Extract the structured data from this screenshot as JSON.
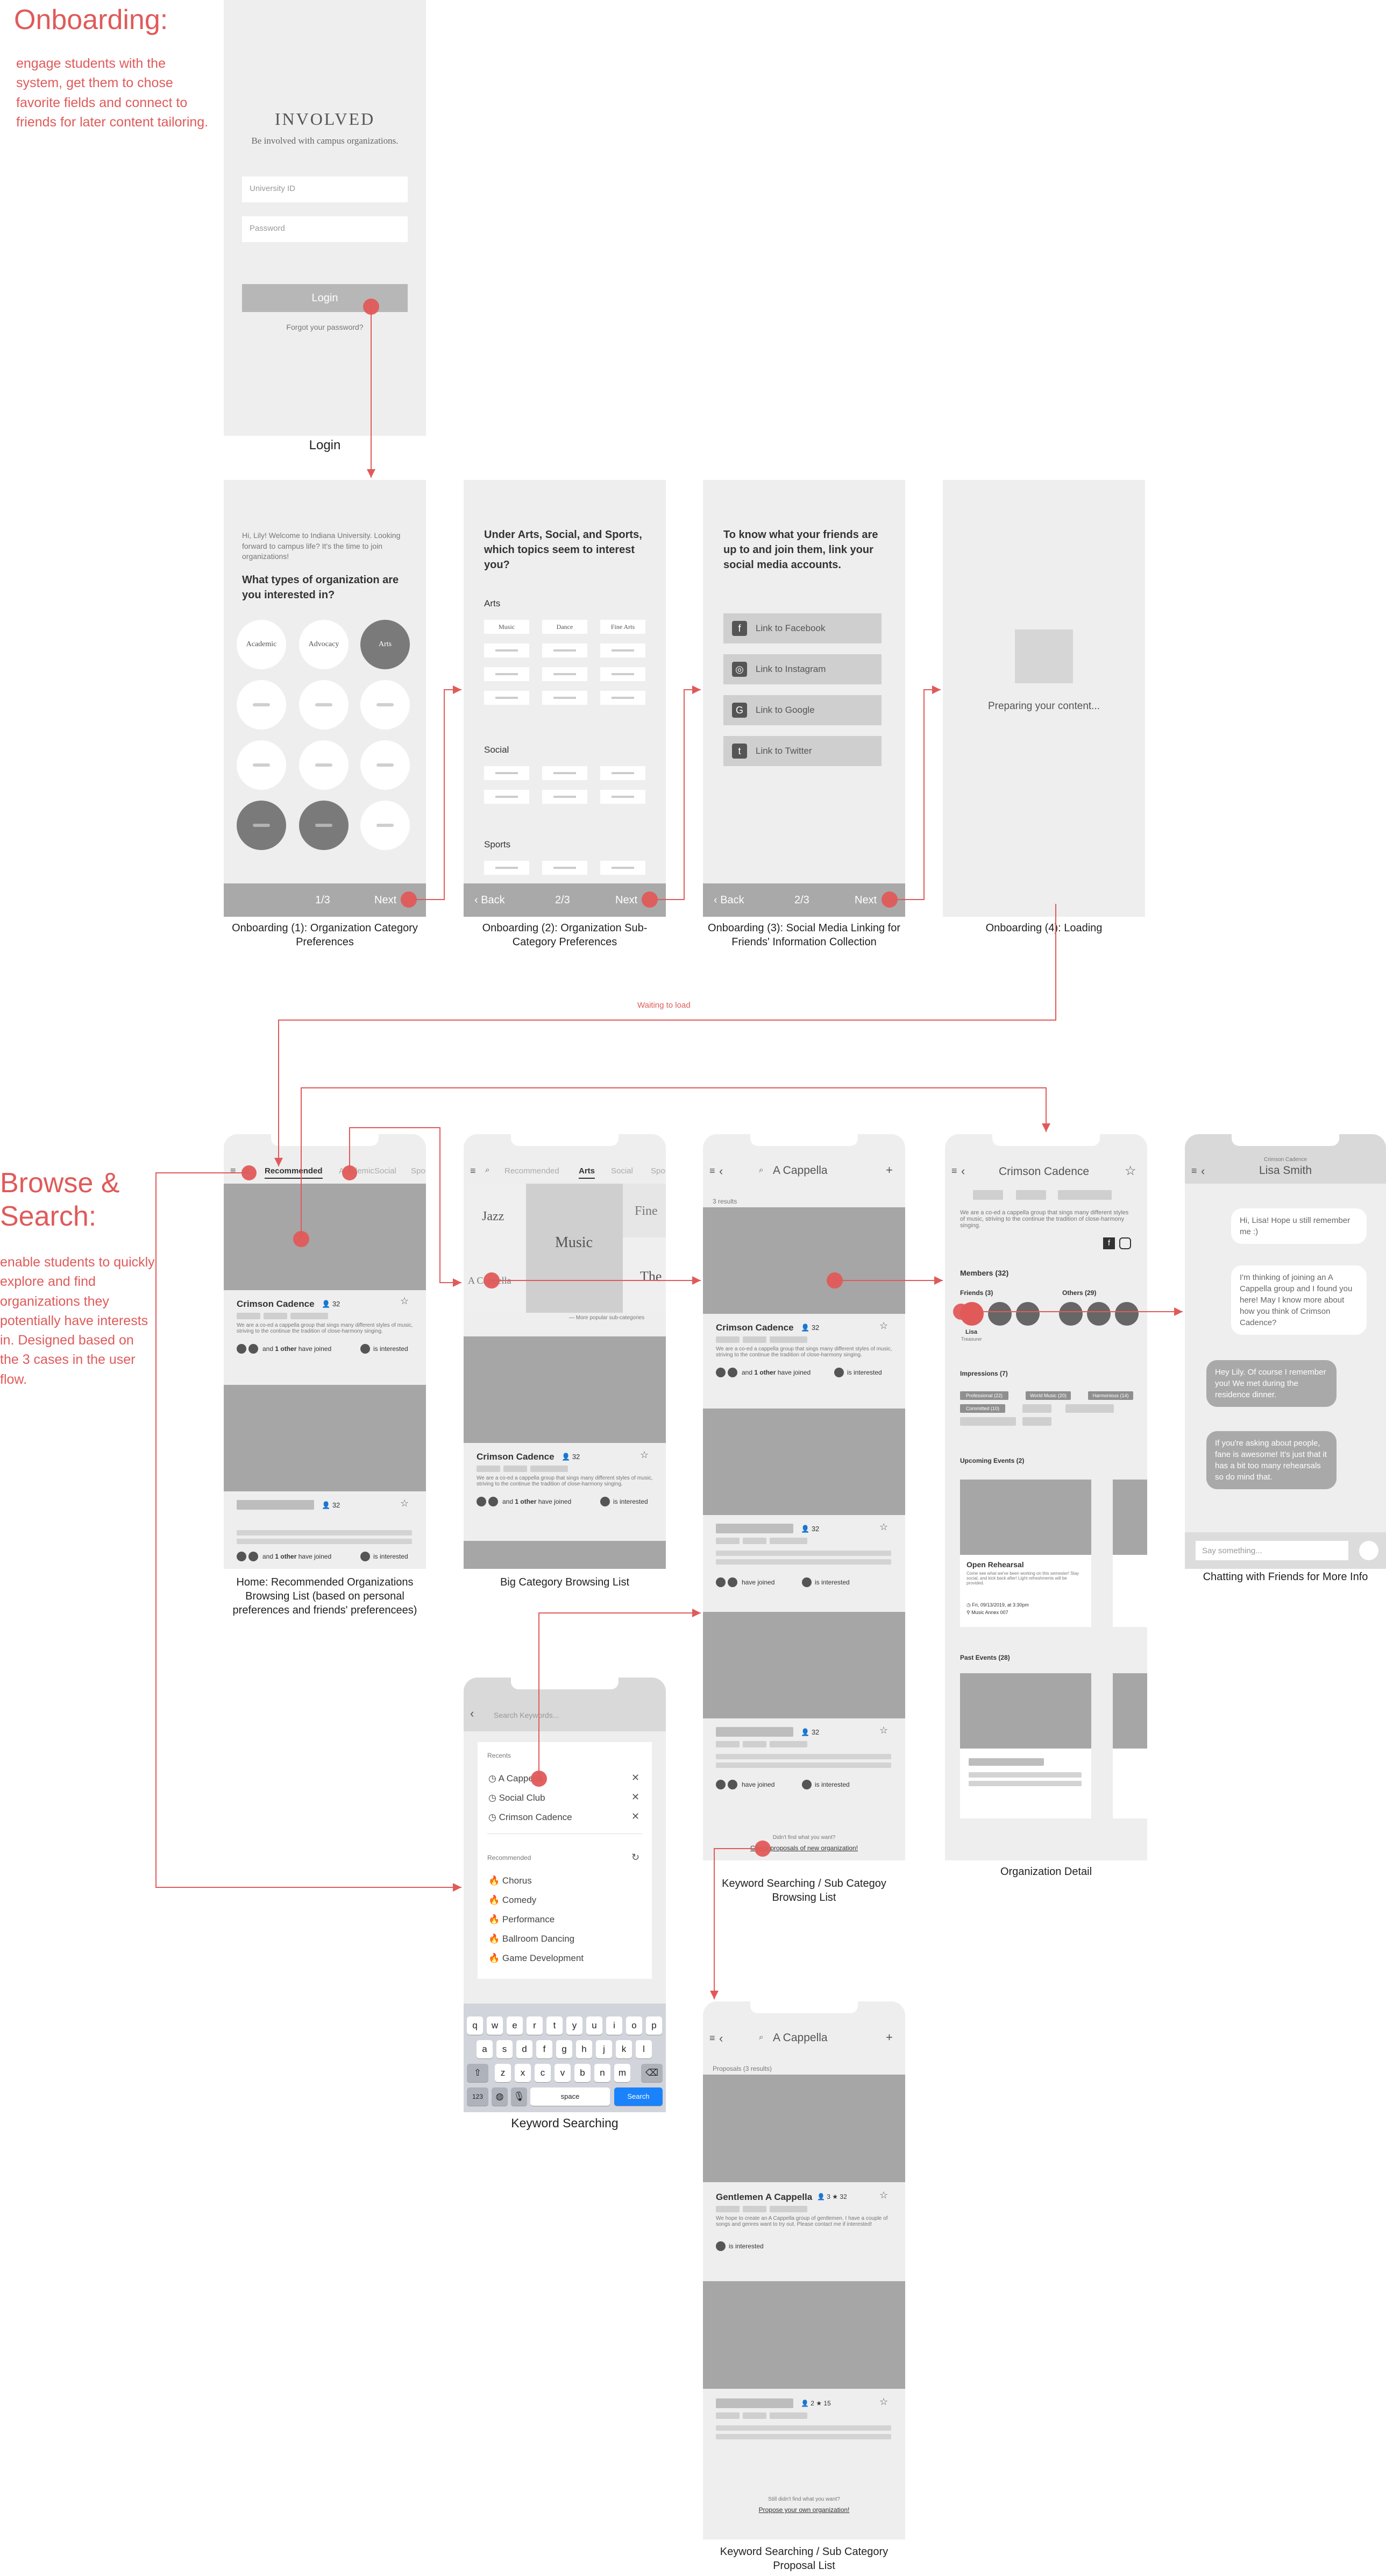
{
  "sections": {
    "onboarding": {
      "title": "Onboarding:",
      "description": "engage students with the system,  get them to chose favorite fields and connect to friends for later content tailoring."
    },
    "browse": {
      "title": "Browse & Search:",
      "description": "enable students to quickly explore and find organizations they potentially have interests in. Designed based on the 3 cases in the user flow."
    }
  },
  "captions": {
    "login": "Login",
    "onb1": "Onboarding (1): Organization Category Preferences",
    "onb2": "Onboarding (2): Organization Sub-Category Preferences",
    "onb3": "Onboarding (3): Social Media Linking for Friends' Information Collection",
    "onb4": "Onboarding (4): Loading",
    "home": "Home: Recommended Organizations Browsing List (based on personal preferences and friends' preferencees)",
    "big_category": "Big Category Browsing List",
    "keyword_sub": "Keyword Searching / Sub Categoy Browsing List",
    "org_detail": "Organization Detail",
    "chat": "Chatting with Friends for More Info",
    "keyword_search": "Keyword Searching",
    "proposal": "Keyword Searching / Sub Category Proposal List"
  },
  "annotations": {
    "waiting": "Waiting to load"
  },
  "login": {
    "app_name": "INVOLVED",
    "tagline": "Be involved with campus organizations.",
    "uid_placeholder": "University ID",
    "password_placeholder": "Password",
    "login_button": "Login",
    "forgot": "Forgot your password?"
  },
  "onb1": {
    "greeting": "Hi, Lily! Welcome to Indiana University. Looking forward to campus life? It's the time to join organizations!",
    "question": "What types of organization are you interested in?",
    "categories": [
      "Academic",
      "Advocacy",
      "Arts"
    ],
    "page": "1/3",
    "next": "Next"
  },
  "onb2": {
    "question": "Under Arts, Social, and Sports, which topics seem to interest you?",
    "arts": "Arts",
    "arts_options": [
      "Music",
      "Dance",
      "Fine Arts"
    ],
    "social": "Social",
    "sports": "Sports",
    "back": "Back",
    "page": "2/3",
    "next": "Next"
  },
  "onb3": {
    "question": "To know what your friends are up to and join them, link your social media accounts.",
    "links": [
      "Link to Facebook",
      "Link to Instagram",
      "Link to Google",
      "Link to Twitter"
    ],
    "back": "Back",
    "page": "2/3",
    "next": "Next"
  },
  "onb4": {
    "loading": "Preparing your content..."
  },
  "home": {
    "tabs": [
      "Recommended",
      "Academic",
      "Social",
      "Sports"
    ],
    "card1": {
      "name": "Crimson Cadence",
      "members": "32",
      "desc": "We are a co-ed a cappella group that sings many different styles of music, striving to the continue the tradition of close-harmony singing.",
      "joined_prefix": "and",
      "joined_bold": "1 other",
      "joined_suffix": "have joined",
      "interested": "is interested"
    },
    "card2": {
      "members": "32",
      "joined_prefix": "and",
      "joined_bold": "1 other",
      "joined_suffix": "have joined",
      "interested": "is interested"
    }
  },
  "bigcat": {
    "tabs": [
      "Recommended",
      "Arts",
      "Social",
      "Sports"
    ],
    "tiles": [
      "Jazz",
      "Music",
      "Fine",
      "A Cappella",
      "The"
    ],
    "more": "— More popular sub-categories",
    "card": {
      "name": "Crimson Cadence",
      "members": "32",
      "desc": "We are a co-ed a cappella group that sings many different styles of music, striving to the continue the tradition of close-harmony singing.",
      "joined_prefix": "and",
      "joined_bold": "1 other",
      "joined_suffix": "have joined",
      "interested": "is interested"
    }
  },
  "kwsub": {
    "search": "A Cappella",
    "results": "3 results",
    "card1": {
      "name": "Crimson Cadence",
      "members": "32",
      "desc": "We are a co-ed a cappella group that sings many different styles of music, striving to the continue the tradition of close-harmony singing.",
      "joined_prefix": "and",
      "joined_bold": "1 other",
      "joined_suffix": "have joined",
      "interested": "is interested"
    },
    "card2": {
      "members": "32",
      "joined": "have joined",
      "interested": "is interested"
    },
    "card3": {
      "members": "32",
      "joined": "have joined",
      "interested": "is interested"
    },
    "didnt_find": "Didn't find what you want?",
    "proposals_link": "Check proposals of new organization!"
  },
  "orgdetail": {
    "name": "Crimson Cadence",
    "desc": "We are a co-ed a cappella group that sings many different styles of music, striving to the continue the tradition of close-harmony singing.",
    "members": "Members (32)",
    "friends": "Friends (3)",
    "others": "Others (29)",
    "friend_name": "Lisa",
    "friend_role": "Treasurer",
    "impressions": "Impressions (7)",
    "impression_tags": [
      "Professional (22)",
      "World Music (20)",
      "Harmonious (14)",
      "Committed (10)"
    ],
    "upcoming": "Upcoming Events (2)",
    "event_title": "Open Rehearsal",
    "event_desc": "Come see what we've been working on this semester! Stay social, and kick back after! Light refreshments will be provided.",
    "event_time": "Fri, 09/13/2019, at 3:30pm",
    "event_place": "Music Annex 007",
    "past": "Past Events (28)"
  },
  "chat": {
    "org": "Crimson Cadence",
    "name": "Lisa Smith",
    "messages": [
      {
        "from": "me",
        "text": "Hi, Lisa! Hope u still remember me :)"
      },
      {
        "from": "me",
        "text": "I'm thinking of joining an A Cappella group and I found you here! May I know more about how you think of Crimson Cadence?"
      },
      {
        "from": "them",
        "text": "Hey Lily. Of course I remember you! We met during the residence dinner."
      },
      {
        "from": "them",
        "text": "If you're asking about people, fane is awesome! It's just that it has a bit too many rehearsals so do mind that."
      }
    ],
    "input_placeholder": "Say something..."
  },
  "kwsearch": {
    "placeholder": "Search Keywords...",
    "recents_label": "Recents",
    "recents": [
      "A Cappella",
      "Social Club",
      "Crimson Cadence"
    ],
    "recommended_label": "Recommended",
    "recommended": [
      "Chorus",
      "Comedy",
      "Performance",
      "Ballroom Dancing",
      "Game Development"
    ],
    "keyboard_row1": [
      "q",
      "w",
      "e",
      "r",
      "t",
      "y",
      "u",
      "i",
      "o",
      "p"
    ],
    "keyboard_row2": [
      "a",
      "s",
      "d",
      "f",
      "g",
      "h",
      "j",
      "k",
      "l"
    ],
    "keyboard_row3": [
      "z",
      "x",
      "c",
      "v",
      "b",
      "n",
      "m"
    ],
    "key_123": "123",
    "key_space": "space",
    "key_search": "Search"
  },
  "proposal": {
    "search": "A Cappella",
    "results": "Proposals (3 results)",
    "card1": {
      "name": "Gentlemen A Cappella",
      "members": "3",
      "stars": "32",
      "desc": "We hope to create an A Cappella group of gentlemen. I have a couple of songs and genres want to try out. Please contact me if interested!",
      "interested": "is interested"
    },
    "card2": {
      "members": "2",
      "stars": "15"
    },
    "didnt_find": "Still didn't find what you want?",
    "propose_link": "Propose your own organization!"
  },
  "colors": {
    "accent": "#e05a5a",
    "placeholder": "#a6a6a6",
    "screen_bg": "#eeeeee",
    "ios_blue": "#1a82fb"
  }
}
